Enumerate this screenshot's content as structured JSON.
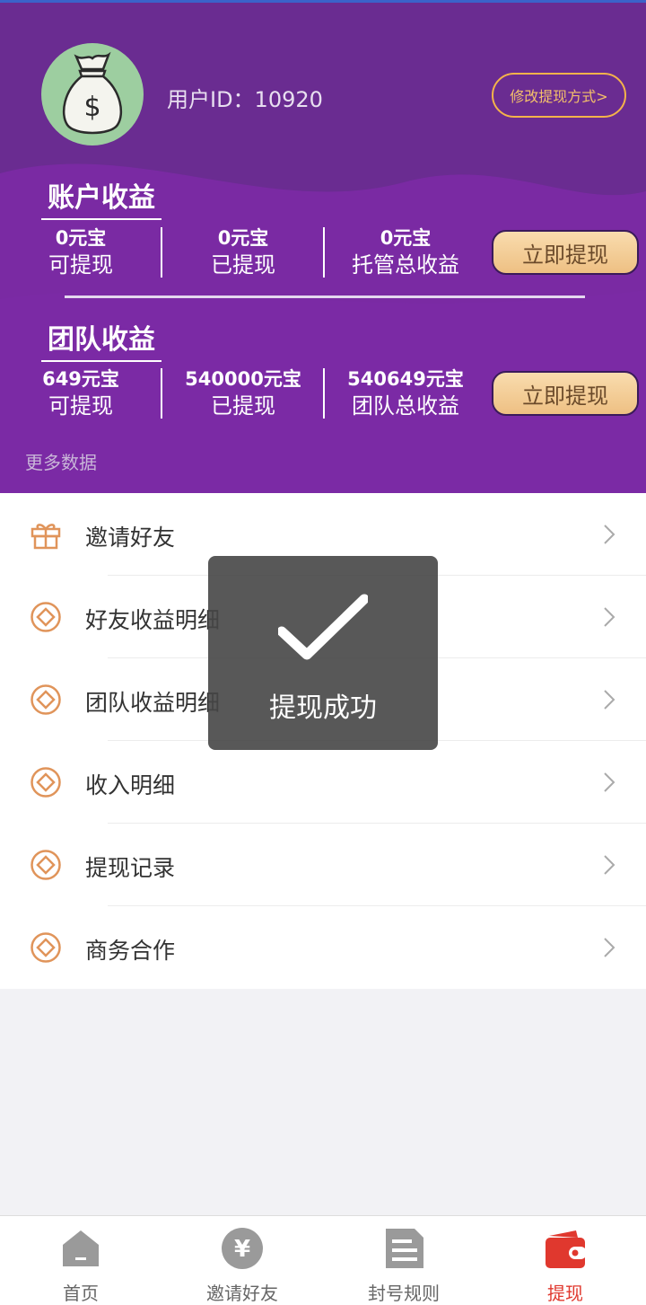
{
  "header": {
    "user_id_label": "用户ID：10920",
    "modify_button": "修改提现方式>",
    "account_section": {
      "title": "账户收益",
      "stats": [
        {
          "value": "0元宝",
          "label": "可提现"
        },
        {
          "value": "0元宝",
          "label": "已提现"
        },
        {
          "value": "0元宝",
          "label": "托管总收益"
        }
      ],
      "button": "立即提现"
    },
    "team_section": {
      "title": "团队收益",
      "stats": [
        {
          "value": "649元宝",
          "label": "可提现"
        },
        {
          "value": "540000元宝",
          "label": "已提现"
        },
        {
          "value": "540649元宝",
          "label": "团队总收益"
        }
      ],
      "button": "立即提现"
    },
    "more_data": "更多数据"
  },
  "menu": {
    "items": [
      {
        "label": "邀请好友",
        "icon": "gift-icon"
      },
      {
        "label": "好友收益明细",
        "icon": "diamond-coin-icon"
      },
      {
        "label": "团队收益明细",
        "icon": "diamond-coin-icon"
      },
      {
        "label": "收入明细",
        "icon": "diamond-coin-icon"
      },
      {
        "label": "提现记录",
        "icon": "diamond-coin-icon"
      },
      {
        "label": "商务合作",
        "icon": "diamond-coin-icon"
      }
    ]
  },
  "toast": {
    "message": "提现成功",
    "icon": "checkmark-icon"
  },
  "tabbar": {
    "tabs": [
      {
        "label": "首页",
        "icon": "home-icon"
      },
      {
        "label": "邀请好友",
        "icon": "yen-coin-icon"
      },
      {
        "label": "封号规则",
        "icon": "document-icon"
      },
      {
        "label": "提现",
        "icon": "wallet-icon"
      }
    ],
    "active_index": 3
  },
  "colors": {
    "header_bg": "#6a2c91",
    "accent_gold": "#f4b34a",
    "icon_orange": "#e0945a",
    "active_tab": "#e0382e"
  }
}
